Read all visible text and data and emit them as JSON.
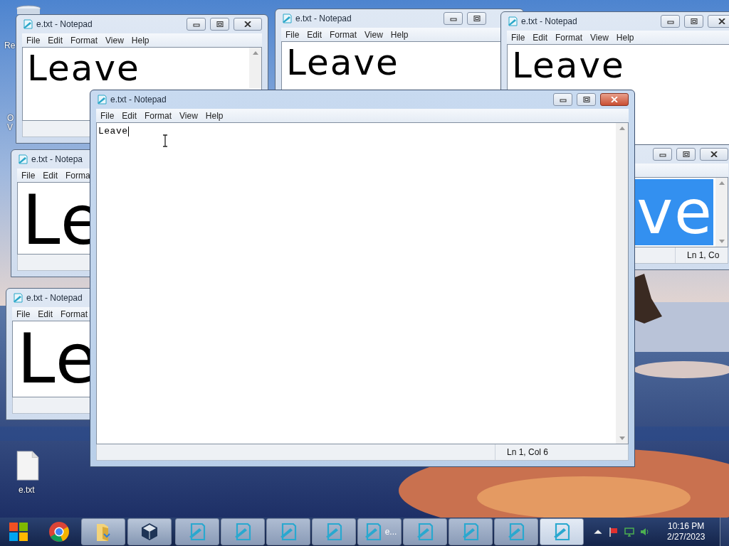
{
  "desktop": {
    "labels": [
      {
        "text": "Re"
      },
      {
        "text": "O"
      },
      {
        "text": "V"
      }
    ],
    "file_icon": {
      "label": "e.txt"
    }
  },
  "windows": [
    {
      "title": "e.txt - Notepad",
      "menu": [
        "File",
        "Edit",
        "Format",
        "View",
        "Help"
      ],
      "text": "Leave",
      "text_selected": false,
      "caret": false,
      "active": false
    },
    {
      "title": "e.txt - Notepad",
      "menu": [
        "File",
        "Edit",
        "Format",
        "View",
        "Help"
      ],
      "text": "Leave",
      "text_selected": false,
      "caret": false,
      "active": false
    },
    {
      "title": "e.txt - Notepad",
      "menu": [
        "File",
        "Edit",
        "Format",
        "View",
        "Help"
      ],
      "text": "Leave",
      "text_selected": false,
      "caret": false,
      "active": false
    },
    {
      "title": "e.txt - Notepa",
      "menu": [
        "File",
        "Edit",
        "Forma"
      ],
      "text": "Le",
      "text_selected": false,
      "caret": false,
      "active": false
    },
    {
      "title": "e.txt - Notepad",
      "menu": [
        "File",
        "Edit",
        "Format"
      ],
      "text": "Le",
      "text_selected": false,
      "caret": false,
      "active": false
    },
    {
      "text": "ve",
      "text_selected": true,
      "caret": false,
      "status": "Ln 1, Co",
      "active": false
    },
    {
      "title": "e.txt - Notepad",
      "menu": [
        "File",
        "Edit",
        "Format",
        "View",
        "Help"
      ],
      "text": "Leave",
      "text_selected": false,
      "caret": true,
      "status": "Ln 1, Col 6",
      "active": true
    }
  ],
  "taskbar": {
    "pinned": [
      {
        "kind": "start"
      },
      {
        "kind": "chrome"
      },
      {
        "kind": "folder"
      },
      {
        "kind": "virtualbox"
      }
    ],
    "notepad_buttons": [
      {
        "selected": false
      },
      {
        "selected": false
      },
      {
        "selected": false
      },
      {
        "selected": false
      },
      {
        "label": "e...",
        "selected": false
      },
      {
        "selected": false
      },
      {
        "selected": false
      },
      {
        "selected": false
      },
      {
        "selected": true
      }
    ],
    "clock": {
      "time": "10:16 PM",
      "date": "2/27/2023"
    }
  }
}
